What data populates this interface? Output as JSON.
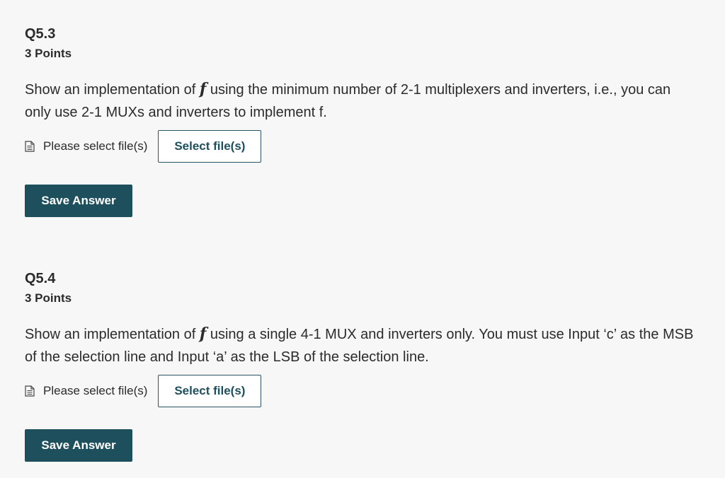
{
  "questions": [
    {
      "title": "Q5.3",
      "points": "3 Points",
      "prompt_before": "Show an implementation of ",
      "func": "f",
      "prompt_after": " using the minimum number of 2-1 multiplexers and inverters, i.e., you can only use 2-1 MUXs and inverters to implement f.",
      "file_status": "Please select file(s)",
      "select_label": "Select file(s)",
      "save_label": "Save Answer"
    },
    {
      "title": "Q5.4",
      "points": "3 Points",
      "prompt_before": "Show an implementation of ",
      "func": "f",
      "prompt_after": " using a single 4-1 MUX and inverters only. You must use Input ‘c’ as the MSB of the selection line and Input ‘a’ as the LSB of the selection line.",
      "file_status": "Please select file(s)",
      "select_label": "Select file(s)",
      "save_label": "Save Answer"
    }
  ],
  "icons": {
    "file": "file-text-icon"
  },
  "colors": {
    "background": "#f7f7f7",
    "accent": "#1e4f5c",
    "text": "#2b2b2b"
  }
}
